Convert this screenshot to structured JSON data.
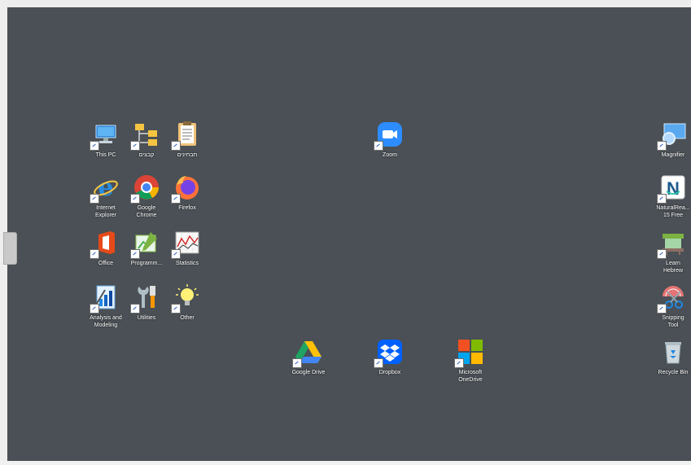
{
  "desktop": {
    "left_column": [
      {
        "label": "This PC",
        "icon": "computer-icon"
      },
      {
        "label": "קבצים",
        "icon": "folder-tree-icon"
      },
      {
        "label": "תבחינים",
        "icon": "clipboard-icon"
      },
      {
        "label": "Internet\nExplorer",
        "icon": "internet-explorer-icon"
      },
      {
        "label": "Google\nChrome",
        "icon": "chrome-icon"
      },
      {
        "label": "Firefox",
        "icon": "firefox-icon"
      },
      {
        "label": "Office",
        "icon": "office-icon"
      },
      {
        "label": "Programm...",
        "icon": "programming-icon"
      },
      {
        "label": "Statistics",
        "icon": "statistics-chart-icon"
      },
      {
        "label": "Analysis and\nModeling",
        "icon": "analysis-icon"
      },
      {
        "label": "Utilities",
        "icon": "tools-icon"
      },
      {
        "label": "Other",
        "icon": "lightbulb-icon"
      }
    ],
    "center": [
      {
        "label": "Zoom",
        "icon": "zoom-icon"
      },
      {
        "label": "Google Drive",
        "icon": "google-drive-icon"
      },
      {
        "label": "Dropbox",
        "icon": "dropbox-icon"
      },
      {
        "label": "Microsoft\nOneDrive",
        "icon": "microsoft-logo-icon"
      }
    ],
    "right_column": [
      {
        "label": "Magnifier",
        "icon": "magnifier-icon"
      },
      {
        "label": "NaturalRea...\n15 Free",
        "icon": "naturalreader-icon"
      },
      {
        "label": "Learn\nHebrew",
        "icon": "learn-hebrew-icon"
      },
      {
        "label": "Snipping\nTool",
        "icon": "scissors-icon"
      },
      {
        "label": "Recycle Bin",
        "icon": "recycle-bin-icon"
      }
    ]
  },
  "colors": {
    "desktop_background": "#4a5055",
    "label_text": "#ffffff"
  }
}
